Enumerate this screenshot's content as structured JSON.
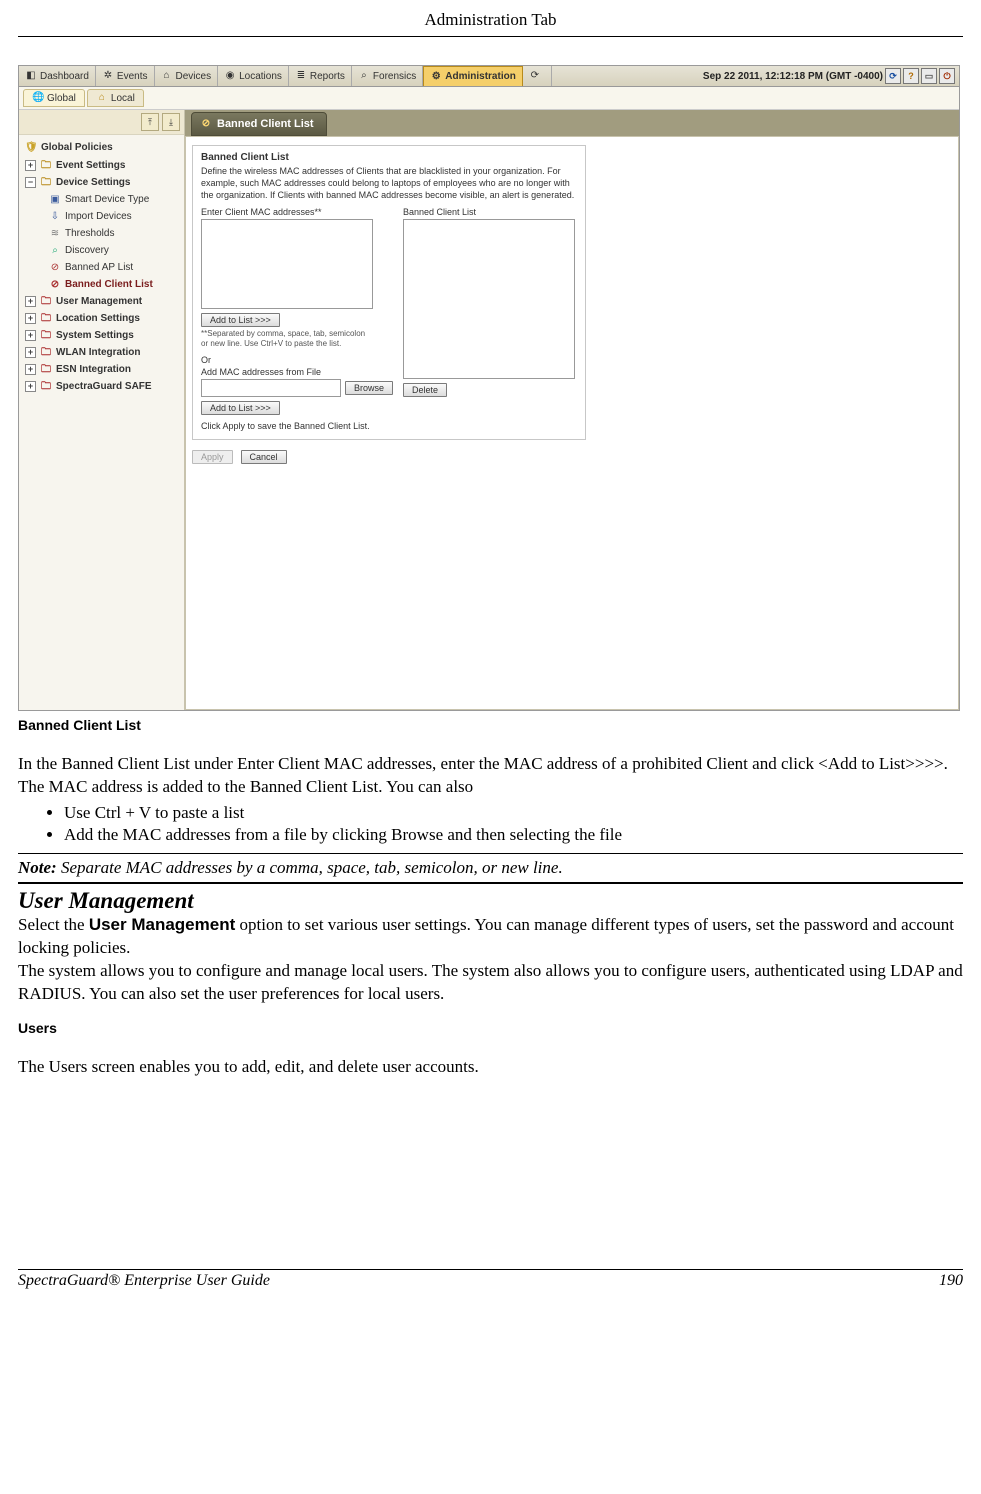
{
  "header": {
    "title": "Administration Tab"
  },
  "footer": {
    "guide": "SpectraGuard®  Enterprise User Guide",
    "page": "190"
  },
  "app": {
    "top_tabs": [
      "Dashboard",
      "Events",
      "Devices",
      "Locations",
      "Reports",
      "Forensics",
      "Administration"
    ],
    "timestamp": "Sep 22 2011, 12:12:18 PM (GMT -0400)",
    "sec_tabs": {
      "global": "Global",
      "local": "Local"
    },
    "big_tab": "Banned Client List",
    "tree": {
      "root": "Global Policies",
      "event_settings": "Event Settings",
      "device_settings": "Device Settings",
      "children": [
        "Smart Device Type",
        "Import Devices",
        "Thresholds",
        "Discovery",
        "Banned AP List",
        "Banned Client List"
      ],
      "siblings": [
        "User Management",
        "Location Settings",
        "System Settings",
        "WLAN Integration",
        "ESN Integration",
        "SpectraGuard SAFE"
      ]
    },
    "panel": {
      "title": "Banned Client List",
      "desc": "Define the wireless MAC addresses of Clients that are blacklisted in your organization. For example, such MAC addresses could belong to laptops of employees who are no longer with the organization. If Clients with banned MAC addresses become visible, an alert is generated.",
      "enter_label": "Enter Client MAC addresses**",
      "list_label": "Banned Client List",
      "add_btn": "Add to List >>>",
      "sep_note": "**Separated by comma, space, tab, semicolon or new line. Use Ctrl+V to paste the list.",
      "or": "Or",
      "file_label": "Add MAC addresses from File",
      "browse": "Browse",
      "add_btn2": "Add to List >>>",
      "delete": "Delete",
      "save_note": "Click Apply to save the Banned Client List.",
      "apply": "Apply",
      "cancel": "Cancel"
    }
  },
  "doc": {
    "caption": "Banned Client List",
    "para1": "In the Banned Client List under Enter Client MAC addresses, enter the MAC address of a prohibited Client and click <Add to List>>>>. The MAC address is added to the Banned Client List. You can also",
    "bullets": [
      "Use Ctrl + V to paste a list",
      "Add the MAC addresses from a file by clicking Browse and then selecting the file"
    ],
    "note_label": "Note:",
    "note_text": " Separate MAC addresses by a comma, space, tab, semicolon, or new line.",
    "h2": "User Management",
    "um_prefix": "Select the ",
    "um_bold": "User Management",
    "um_suffix": " option to set various user settings. You can manage different types of  users, set the password and account locking policies.",
    "um_para2": "The system allows you to configure and manage local users. The system also allows you to configure users, authenticated using  LDAP and RADIUS. You can also set the user preferences for local users.",
    "h3": "Users",
    "users_text": "The Users screen enables you to add, edit, and delete user accounts."
  }
}
